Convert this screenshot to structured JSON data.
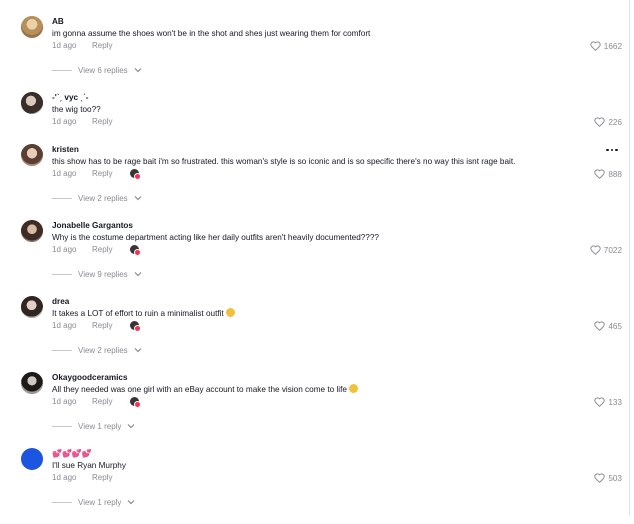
{
  "comments": [
    {
      "username": "AB",
      "text": "im gonna assume the shoes won't be in the shot and shes just wearing them for comfort",
      "time": "1d ago",
      "reply_label": "Reply",
      "likes": "1662",
      "view_replies": "View 6 replies",
      "creator_liked": false,
      "avatar_color": "#c8a878"
    },
    {
      "username": "-'ˋˏ vyc ˎˊ-",
      "text": "the wig too??",
      "time": "1d ago",
      "reply_label": "Reply",
      "likes": "226",
      "view_replies": "",
      "creator_liked": false,
      "avatar_color": "#4a3f3a"
    },
    {
      "username": "kristen",
      "text": "this show has to be rage bait i'm so frustrated. this woman's style is so iconic and is so specific there's no way this isnt rage bait.",
      "time": "1d ago",
      "reply_label": "Reply",
      "likes": "888",
      "view_replies": "View 2 replies",
      "creator_liked": true,
      "avatar_color": "#9a7a66"
    },
    {
      "username": "Jonabelle Gargantos",
      "text": "Why is the costume department acting like her daily outfits aren't heavily documented????",
      "time": "1d ago",
      "reply_label": "Reply",
      "likes": "7022",
      "view_replies": "View 9 replies",
      "creator_liked": true,
      "avatar_color": "#6b5248"
    },
    {
      "username": "drea",
      "text": "It takes a LOT of effort to ruin a minimalist outfit",
      "time": "1d ago",
      "reply_label": "Reply",
      "likes": "465",
      "view_replies": "View 2 replies",
      "creator_liked": true,
      "avatar_color": "#8f7b74"
    },
    {
      "username": "Okaygoodceramics",
      "text": "All they needed was one girl with an eBay account to make the vision come to life",
      "time": "1d ago",
      "reply_label": "Reply",
      "likes": "133",
      "view_replies": "View 1 reply",
      "creator_liked": true,
      "avatar_color": "#5d5a58"
    },
    {
      "username": "💕💕💕💕",
      "text": "I'll sue Ryan Murphy",
      "time": "1d ago",
      "reply_label": "Reply",
      "likes": "503",
      "view_replies": "View 1 reply",
      "creator_liked": false,
      "avatar_color": "#1c55e0"
    }
  ],
  "icons": {
    "like": "heart-outline-icon",
    "expand": "chevron-down-icon",
    "more": "more-options-icon"
  },
  "colors": {
    "muted_text": "#8a8b91",
    "primary_text": "#161823",
    "creator_badge_dot": "#fe2c55"
  }
}
